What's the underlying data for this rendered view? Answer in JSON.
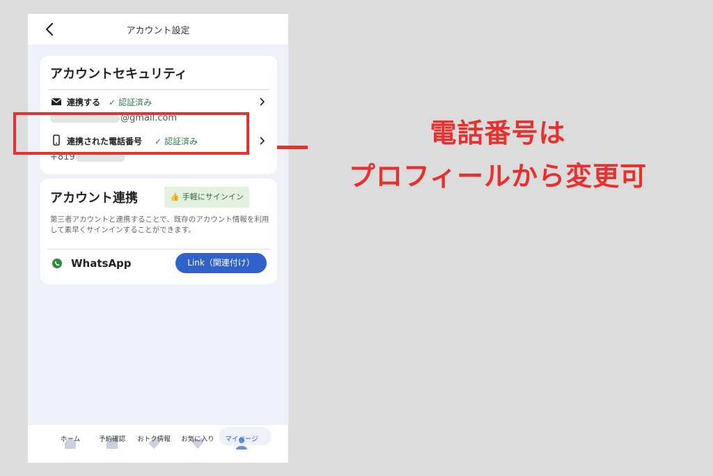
{
  "header": {
    "title": "アカウント設定"
  },
  "security": {
    "title": "アカウントセキュリティ",
    "email_row": {
      "label": "連携する",
      "status": "認証済み",
      "value_suffix": "@gmail.com"
    },
    "phone_row": {
      "label": "連携された電話番号",
      "status": "認証済み",
      "value_prefix": "+819"
    }
  },
  "callout": {
    "line1": "電話番号は",
    "line2": "プロフィールから変更可"
  },
  "linking": {
    "title": "アカウント連携",
    "badge": "手軽にサインイン",
    "description": "第三者アカウントと連携することで、既存のアカウント情報を利用して素早くサインインすることができます。",
    "whatsapp_label": "WhatsApp",
    "link_button": "Link（関連付け）"
  },
  "tabbar": {
    "items": [
      {
        "label": "ホーム"
      },
      {
        "label": "予約確認"
      },
      {
        "label": "おトク情報"
      },
      {
        "label": "お気に入り"
      },
      {
        "label": "マイページ"
      }
    ]
  },
  "colors": {
    "accent_red": "#e8302f",
    "verified_green": "#2f7d4b",
    "link_blue": "#2f63c9",
    "whatsapp_green": "#2e8b3d"
  }
}
